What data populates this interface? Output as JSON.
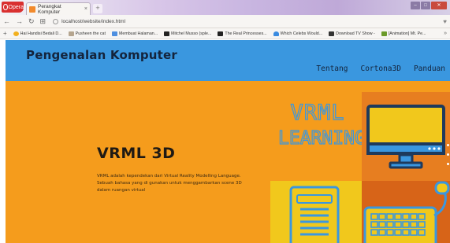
{
  "browser": {
    "menu_label": "Opera",
    "tab_title": "Perangkat Komputer",
    "new_tab": "+",
    "address": "localhost/website/index.html",
    "bookmarks": [
      {
        "label": "Hai Handisi Bedali D...",
        "icon": "sun-icon",
        "color": "#f2b01e"
      },
      {
        "label": "Pusheen the cat",
        "icon": "cat-icon",
        "color": "#b5a58f"
      },
      {
        "label": "Membuat Halaman...",
        "icon": "page-icon",
        "color": "#4e8fe0"
      },
      {
        "label": "Mitchel Musso (sple...",
        "icon": "video-icon",
        "color": "#222222"
      },
      {
        "label": "The Real Princesses...",
        "icon": "video-icon",
        "color": "#222222"
      },
      {
        "label": "Which Celebs Would...",
        "icon": "person-icon",
        "color": "#3a8be0"
      },
      {
        "label": "Download TV Show -",
        "icon": "tv-icon",
        "color": "#333333"
      },
      {
        "label": "[Animation] Mt. Pe...",
        "icon": "number-icon",
        "color": "#6a9a2a"
      }
    ],
    "bookmarks_more": "»"
  },
  "site": {
    "title": "Pengenalan Komputer",
    "nav": [
      "Tentang",
      "Cortona3D",
      "Panduan"
    ]
  },
  "hero": {
    "title": "VRML 3D",
    "description": "VRML adalah kependekan dari Virtual Reality Modelling Language. Sebuah bahasa yang di gunakan untuk menggambarkan scene 3D dalam ruangan virtual",
    "logo_line1": "VRML",
    "logo_line2": "LEARNING"
  },
  "colors": {
    "header_blue": "#3a97df",
    "hero_orange": "#f59c1c",
    "monitor_tile": "#e77e20",
    "doc_tile": "#f1c81c",
    "keyboard_tile": "#d76418",
    "navy": "#14243c"
  }
}
